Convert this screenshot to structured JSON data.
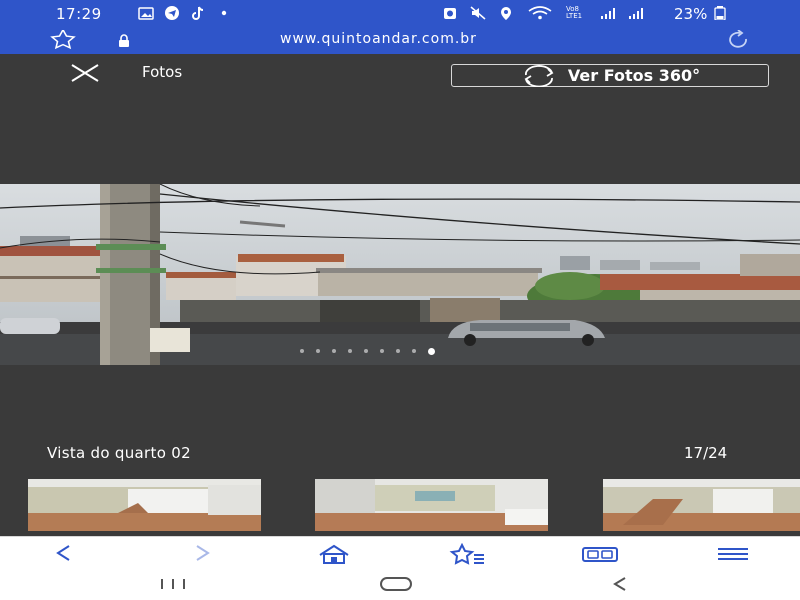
{
  "status_bar": {
    "time": "17:29",
    "battery_text": "23%",
    "network_label": "Vo8 LTE1"
  },
  "browser": {
    "url": "www.quintoandar.com.br"
  },
  "viewer": {
    "title": "Fotos",
    "view360_label": "Ver Fotos 360°",
    "caption": "Vista do quarto 02",
    "counter": "17/24"
  },
  "icons": {
    "close": "close-icon",
    "rotate360": "rotate-360-icon",
    "bookmark": "star-icon",
    "lock": "lock-icon",
    "reload": "reload-icon",
    "back": "chevron-left-icon",
    "forward": "chevron-right-icon",
    "home": "home-icon",
    "bookmarks": "bookmarks-icon",
    "tabs": "tabs-icon",
    "menu": "hamburger-menu-icon"
  },
  "colors": {
    "status_bar": "#2f55c9",
    "viewer_bg": "#3a3a3a",
    "nav_icon": "#2f55c9"
  }
}
